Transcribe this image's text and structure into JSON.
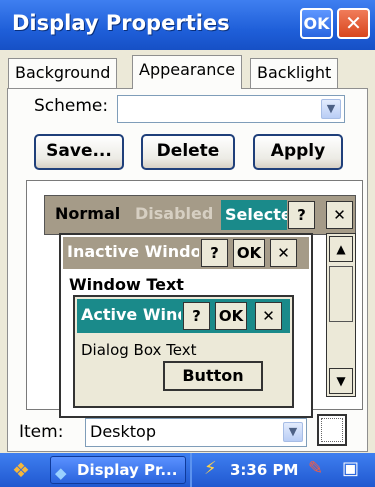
{
  "window": {
    "title": "Display Properties",
    "ok_label": "OK",
    "close_glyph": "✕"
  },
  "tabs": [
    {
      "label": "Background"
    },
    {
      "label": "Appearance"
    },
    {
      "label": "Backlight"
    }
  ],
  "scheme": {
    "label": "Scheme:",
    "value": "",
    "arrow_glyph": "▼"
  },
  "buttons": {
    "save": "Save...",
    "delete": "Delete",
    "apply": "Apply"
  },
  "preview": {
    "menu_normal": "Normal",
    "menu_disabled": "Disabled",
    "menu_selected": "Selected",
    "help_glyph": "?",
    "close_glyph": "✕",
    "ok_glyph": "OK",
    "inactive_title": "Inactive Window",
    "window_text": "Window Text",
    "active_title": "Active Window",
    "dialog_text": "Dialog Box Text",
    "button_label": "Button",
    "scroll_up": "▲",
    "scroll_down": "▼"
  },
  "item": {
    "label": "Item:",
    "value": "Desktop"
  },
  "taskbar": {
    "task_label": "Display Pr...",
    "clock": "3:36 PM"
  },
  "colors": {
    "titlebar": "#2a66e0",
    "selected": "#1a8a8a",
    "inactive": "#a59b88"
  }
}
